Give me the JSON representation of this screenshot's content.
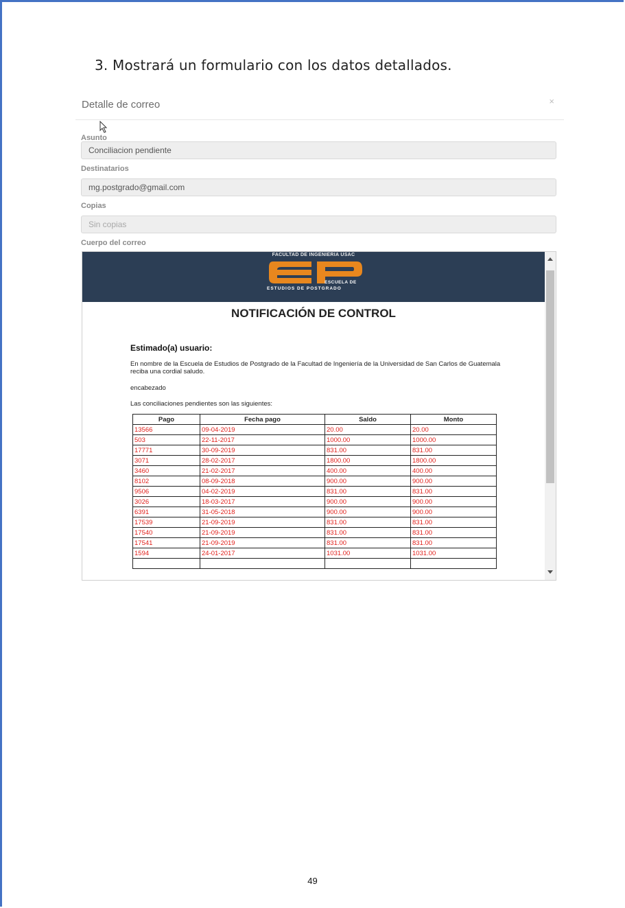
{
  "step_text": "3. Mostrará un formulario con los datos detallados.",
  "modal": {
    "title": "Detalle de correo",
    "close": "×",
    "fields": {
      "asunto_label": "Asunto",
      "asunto_value": "Conciliacion pendiente",
      "destinatarios_label": "Destinatarios",
      "destinatarios_value": "mg.postgrado@gmail.com",
      "copias_label": "Copias",
      "copias_placeholder": "Sin copias",
      "cuerpo_label": "Cuerpo del correo"
    }
  },
  "email": {
    "banner_top": "FACULTAD DE INGENIERIA USAC",
    "banner_sub1": "ESCUELA DE",
    "banner_sub2": "ESTUDIOS DE POSTGRADO",
    "logo_color": "#e8871e",
    "title": "NOTIFICACIÓN DE CONTROL",
    "greeting": "Estimado(a) usuario:",
    "paragraph": "En nombre de la Escuela de Estudios de Postgrado de la Facultad de Ingeniería de la Universidad de San Carlos de Guatemala reciba una cordial saludo.",
    "header_word": "encabezado",
    "intro": "Las conciliaciones pendientes son las siguientes:",
    "table": {
      "headers": [
        "Pago",
        "Fecha pago",
        "Saldo",
        "Monto"
      ],
      "rows": [
        [
          "13566",
          "09-04-2019",
          "20.00",
          "20.00"
        ],
        [
          "503",
          "22-11-2017",
          "1000.00",
          "1000.00"
        ],
        [
          "17771",
          "30-09-2019",
          "831.00",
          "831.00"
        ],
        [
          "3071",
          "28-02-2017",
          "1800.00",
          "1800.00"
        ],
        [
          "3460",
          "21-02-2017",
          "400.00",
          "400.00"
        ],
        [
          "8102",
          "08-09-2018",
          "900.00",
          "900.00"
        ],
        [
          "9506",
          "04-02-2019",
          "831.00",
          "831.00"
        ],
        [
          "3026",
          "18-03-2017",
          "900.00",
          "900.00"
        ],
        [
          "6391",
          "31-05-2018",
          "900.00",
          "900.00"
        ],
        [
          "17539",
          "21-09-2019",
          "831.00",
          "831.00"
        ],
        [
          "17540",
          "21-09-2019",
          "831.00",
          "831.00"
        ],
        [
          "17541",
          "21-09-2019",
          "831.00",
          "831.00"
        ],
        [
          "1594",
          "24-01-2017",
          "1031.00",
          "1031.00"
        ],
        [
          "",
          "",
          "",
          ""
        ]
      ]
    }
  },
  "page_number": "49",
  "colors": {
    "banner": "#2c3e55",
    "table_text": "#e0201b",
    "frame_border": "#4472c4"
  }
}
